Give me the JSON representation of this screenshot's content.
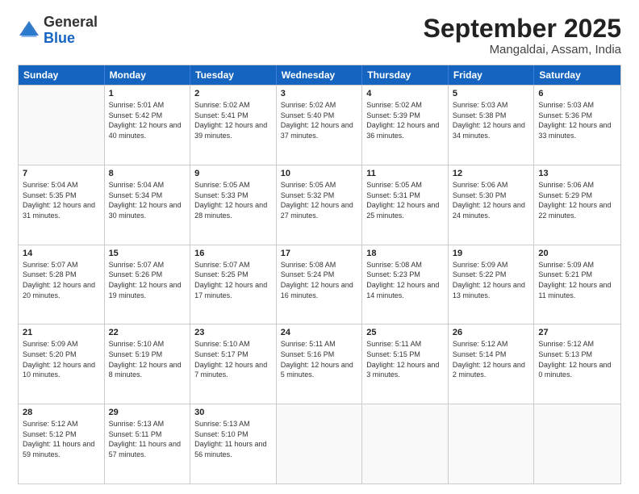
{
  "header": {
    "logo_general": "General",
    "logo_blue": "Blue",
    "month_title": "September 2025",
    "location": "Mangaldai, Assam, India"
  },
  "days_of_week": [
    "Sunday",
    "Monday",
    "Tuesday",
    "Wednesday",
    "Thursday",
    "Friday",
    "Saturday"
  ],
  "weeks": [
    [
      {
        "day": "",
        "sunrise": "",
        "sunset": "",
        "daylight": ""
      },
      {
        "day": "1",
        "sunrise": "Sunrise: 5:01 AM",
        "sunset": "Sunset: 5:42 PM",
        "daylight": "Daylight: 12 hours and 40 minutes."
      },
      {
        "day": "2",
        "sunrise": "Sunrise: 5:02 AM",
        "sunset": "Sunset: 5:41 PM",
        "daylight": "Daylight: 12 hours and 39 minutes."
      },
      {
        "day": "3",
        "sunrise": "Sunrise: 5:02 AM",
        "sunset": "Sunset: 5:40 PM",
        "daylight": "Daylight: 12 hours and 37 minutes."
      },
      {
        "day": "4",
        "sunrise": "Sunrise: 5:02 AM",
        "sunset": "Sunset: 5:39 PM",
        "daylight": "Daylight: 12 hours and 36 minutes."
      },
      {
        "day": "5",
        "sunrise": "Sunrise: 5:03 AM",
        "sunset": "Sunset: 5:38 PM",
        "daylight": "Daylight: 12 hours and 34 minutes."
      },
      {
        "day": "6",
        "sunrise": "Sunrise: 5:03 AM",
        "sunset": "Sunset: 5:36 PM",
        "daylight": "Daylight: 12 hours and 33 minutes."
      }
    ],
    [
      {
        "day": "7",
        "sunrise": "Sunrise: 5:04 AM",
        "sunset": "Sunset: 5:35 PM",
        "daylight": "Daylight: 12 hours and 31 minutes."
      },
      {
        "day": "8",
        "sunrise": "Sunrise: 5:04 AM",
        "sunset": "Sunset: 5:34 PM",
        "daylight": "Daylight: 12 hours and 30 minutes."
      },
      {
        "day": "9",
        "sunrise": "Sunrise: 5:05 AM",
        "sunset": "Sunset: 5:33 PM",
        "daylight": "Daylight: 12 hours and 28 minutes."
      },
      {
        "day": "10",
        "sunrise": "Sunrise: 5:05 AM",
        "sunset": "Sunset: 5:32 PM",
        "daylight": "Daylight: 12 hours and 27 minutes."
      },
      {
        "day": "11",
        "sunrise": "Sunrise: 5:05 AM",
        "sunset": "Sunset: 5:31 PM",
        "daylight": "Daylight: 12 hours and 25 minutes."
      },
      {
        "day": "12",
        "sunrise": "Sunrise: 5:06 AM",
        "sunset": "Sunset: 5:30 PM",
        "daylight": "Daylight: 12 hours and 24 minutes."
      },
      {
        "day": "13",
        "sunrise": "Sunrise: 5:06 AM",
        "sunset": "Sunset: 5:29 PM",
        "daylight": "Daylight: 12 hours and 22 minutes."
      }
    ],
    [
      {
        "day": "14",
        "sunrise": "Sunrise: 5:07 AM",
        "sunset": "Sunset: 5:28 PM",
        "daylight": "Daylight: 12 hours and 20 minutes."
      },
      {
        "day": "15",
        "sunrise": "Sunrise: 5:07 AM",
        "sunset": "Sunset: 5:26 PM",
        "daylight": "Daylight: 12 hours and 19 minutes."
      },
      {
        "day": "16",
        "sunrise": "Sunrise: 5:07 AM",
        "sunset": "Sunset: 5:25 PM",
        "daylight": "Daylight: 12 hours and 17 minutes."
      },
      {
        "day": "17",
        "sunrise": "Sunrise: 5:08 AM",
        "sunset": "Sunset: 5:24 PM",
        "daylight": "Daylight: 12 hours and 16 minutes."
      },
      {
        "day": "18",
        "sunrise": "Sunrise: 5:08 AM",
        "sunset": "Sunset: 5:23 PM",
        "daylight": "Daylight: 12 hours and 14 minutes."
      },
      {
        "day": "19",
        "sunrise": "Sunrise: 5:09 AM",
        "sunset": "Sunset: 5:22 PM",
        "daylight": "Daylight: 12 hours and 13 minutes."
      },
      {
        "day": "20",
        "sunrise": "Sunrise: 5:09 AM",
        "sunset": "Sunset: 5:21 PM",
        "daylight": "Daylight: 12 hours and 11 minutes."
      }
    ],
    [
      {
        "day": "21",
        "sunrise": "Sunrise: 5:09 AM",
        "sunset": "Sunset: 5:20 PM",
        "daylight": "Daylight: 12 hours and 10 minutes."
      },
      {
        "day": "22",
        "sunrise": "Sunrise: 5:10 AM",
        "sunset": "Sunset: 5:19 PM",
        "daylight": "Daylight: 12 hours and 8 minutes."
      },
      {
        "day": "23",
        "sunrise": "Sunrise: 5:10 AM",
        "sunset": "Sunset: 5:17 PM",
        "daylight": "Daylight: 12 hours and 7 minutes."
      },
      {
        "day": "24",
        "sunrise": "Sunrise: 5:11 AM",
        "sunset": "Sunset: 5:16 PM",
        "daylight": "Daylight: 12 hours and 5 minutes."
      },
      {
        "day": "25",
        "sunrise": "Sunrise: 5:11 AM",
        "sunset": "Sunset: 5:15 PM",
        "daylight": "Daylight: 12 hours and 3 minutes."
      },
      {
        "day": "26",
        "sunrise": "Sunrise: 5:12 AM",
        "sunset": "Sunset: 5:14 PM",
        "daylight": "Daylight: 12 hours and 2 minutes."
      },
      {
        "day": "27",
        "sunrise": "Sunrise: 5:12 AM",
        "sunset": "Sunset: 5:13 PM",
        "daylight": "Daylight: 12 hours and 0 minutes."
      }
    ],
    [
      {
        "day": "28",
        "sunrise": "Sunrise: 5:12 AM",
        "sunset": "Sunset: 5:12 PM",
        "daylight": "Daylight: 11 hours and 59 minutes."
      },
      {
        "day": "29",
        "sunrise": "Sunrise: 5:13 AM",
        "sunset": "Sunset: 5:11 PM",
        "daylight": "Daylight: 11 hours and 57 minutes."
      },
      {
        "day": "30",
        "sunrise": "Sunrise: 5:13 AM",
        "sunset": "Sunset: 5:10 PM",
        "daylight": "Daylight: 11 hours and 56 minutes."
      },
      {
        "day": "",
        "sunrise": "",
        "sunset": "",
        "daylight": ""
      },
      {
        "day": "",
        "sunrise": "",
        "sunset": "",
        "daylight": ""
      },
      {
        "day": "",
        "sunrise": "",
        "sunset": "",
        "daylight": ""
      },
      {
        "day": "",
        "sunrise": "",
        "sunset": "",
        "daylight": ""
      }
    ]
  ]
}
